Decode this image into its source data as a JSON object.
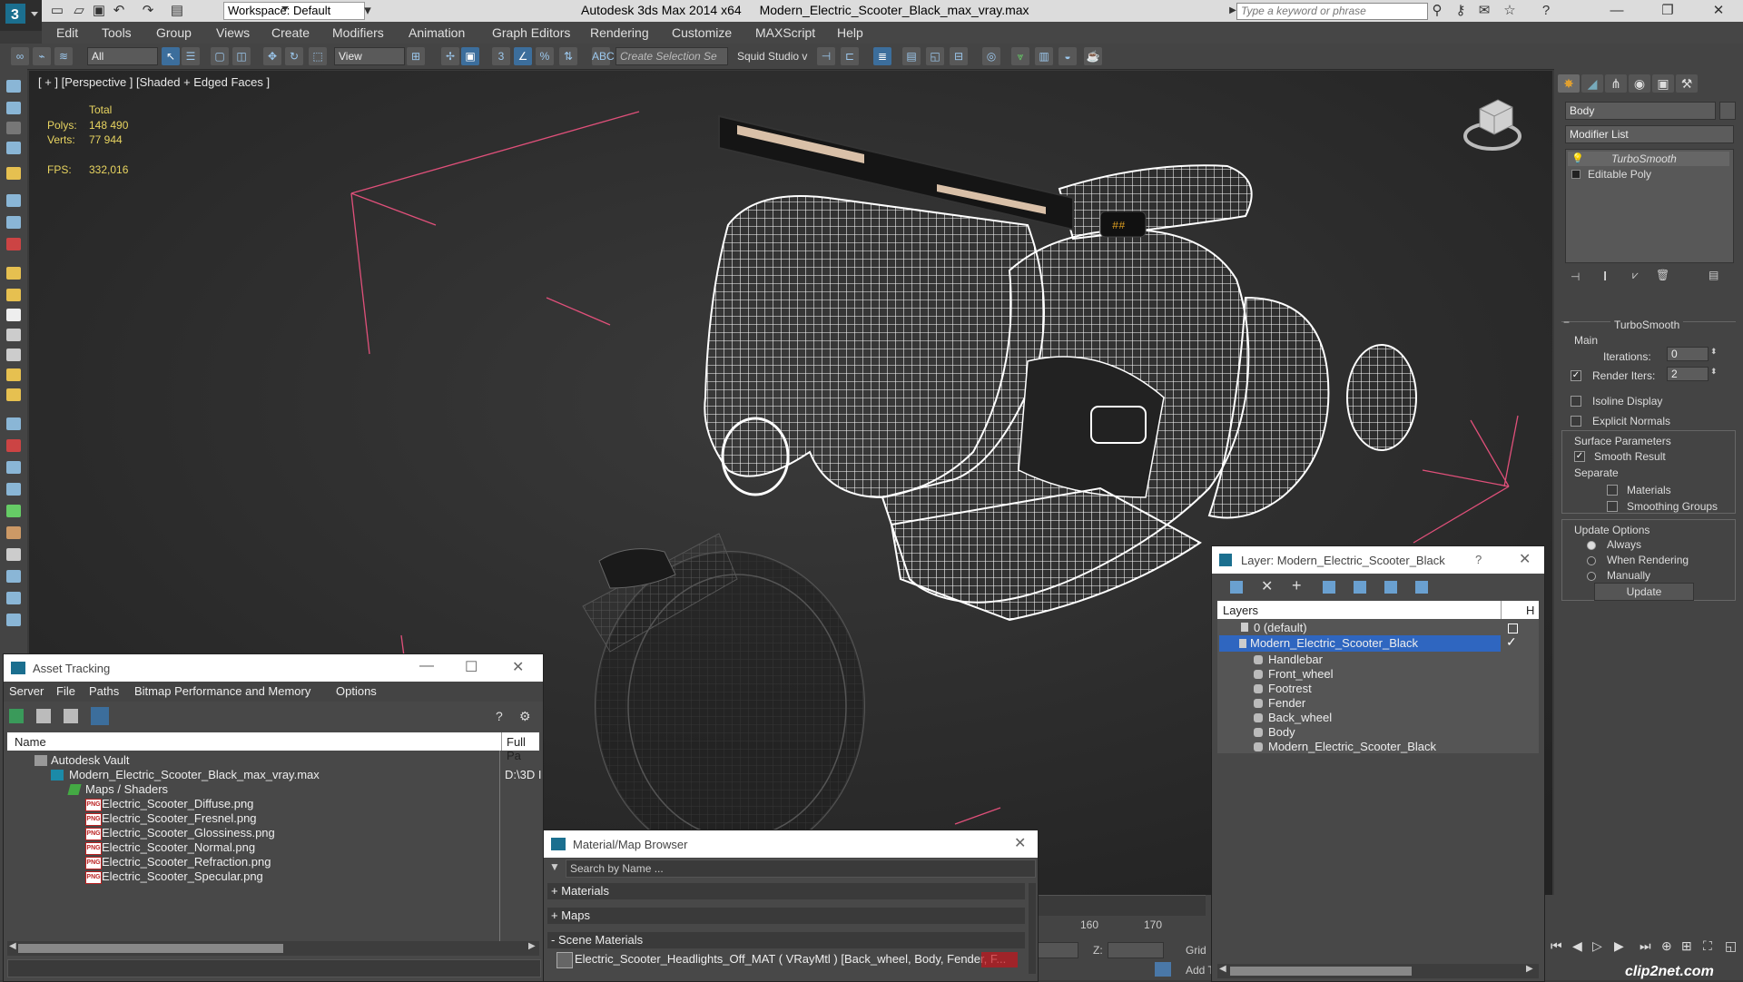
{
  "titlebar": {
    "workspace": "Workspace: Default",
    "app_title": "Autodesk 3ds Max  2014 x64",
    "file_title": "Modern_Electric_Scooter_Black_max_vray.max",
    "search_placeholder": "Type a keyword or phrase"
  },
  "menu": [
    "Edit",
    "Tools",
    "Group",
    "Views",
    "Create",
    "Modifiers",
    "Animation",
    "Graph Editors",
    "Rendering",
    "Customize",
    "MAXScript",
    "Help"
  ],
  "toolbar": {
    "filter_select": "All",
    "view_select": "View",
    "selection_set": "Create Selection Se",
    "squid": "Squid Studio v"
  },
  "viewport": {
    "label": "[ + ] [Perspective ] [Shaded + Edged Faces ]",
    "total_label": "Total",
    "polys_label": "Polys:",
    "polys_value": "148 490",
    "verts_label": "Verts:",
    "verts_value": "77 944",
    "fps_label": "FPS:",
    "fps_value": "332,016"
  },
  "command_panel": {
    "object_name": "Body",
    "modifier_list": "Modifier List",
    "stack": [
      "TurboSmooth",
      "Editable Poly"
    ],
    "rollout_title": "TurboSmooth",
    "main_label": "Main",
    "iterations_label": "Iterations:",
    "iterations_value": "0",
    "render_iters_label": "Render Iters:",
    "render_iters_value": "2",
    "isoline": "Isoline Display",
    "explicit_normals": "Explicit Normals",
    "surface_params": "Surface Parameters",
    "smooth_result": "Smooth Result",
    "separate": "Separate",
    "materials": "Materials",
    "smoothing_groups": "Smoothing Groups",
    "update_options": "Update Options",
    "always": "Always",
    "when_rendering": "When Rendering",
    "manually": "Manually",
    "update_btn": "Update"
  },
  "layer_window": {
    "title": "Layer: Modern_Electric_Scooter_Black",
    "help": "?",
    "col_layers": "Layers",
    "col_h": "H",
    "rows": [
      "0 (default)",
      "Modern_Electric_Scooter_Black",
      "Handlebar",
      "Front_wheel",
      "Footrest",
      "Fender",
      "Back_wheel",
      "Body",
      "Modern_Electric_Scooter_Black"
    ]
  },
  "asset_window": {
    "title": "Asset Tracking",
    "menu": [
      "Server",
      "File",
      "Paths",
      "Bitmap Performance and Memory",
      "Options"
    ],
    "col_name": "Name",
    "col_path": "Full Pa",
    "rows": [
      {
        "name": "Autodesk Vault",
        "path": ""
      },
      {
        "name": "Modern_Electric_Scooter_Black_max_vray.max",
        "path": "D:\\3D I"
      },
      {
        "name": "Maps / Shaders",
        "path": ""
      },
      {
        "name": "Electric_Scooter_Diffuse.png",
        "path": ""
      },
      {
        "name": "Electric_Scooter_Fresnel.png",
        "path": ""
      },
      {
        "name": "Electric_Scooter_Glossiness.png",
        "path": ""
      },
      {
        "name": "Electric_Scooter_Normal.png",
        "path": ""
      },
      {
        "name": "Electric_Scooter_Refraction.png",
        "path": ""
      },
      {
        "name": "Electric_Scooter_Specular.png",
        "path": ""
      }
    ]
  },
  "material_browser": {
    "title": "Material/Map Browser",
    "search_placeholder": "Search by Name ...",
    "sections": [
      "+ Materials",
      "+ Maps",
      "- Scene Materials"
    ],
    "scene_item": "Electric_Scooter_Headlights_Off_MAT  ( VRayMtl ) [Back_wheel, Body, Fender, F..."
  },
  "timeline": {
    "ticks": [
      "160",
      "170"
    ],
    "z_label": "Z:",
    "grid_label": "Grid",
    "add_label": "Add T"
  },
  "watermark": "clip2net.com"
}
